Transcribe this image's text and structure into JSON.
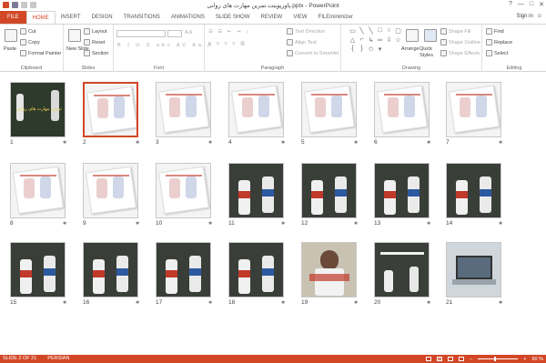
{
  "window": {
    "title": "پاورپوینت تمرین مهارت های روانی.pptx - PowerPoint",
    "controls": [
      "?",
      "—",
      "□",
      "✕"
    ]
  },
  "tabs": [
    {
      "label": "FILE"
    },
    {
      "label": "HOME"
    },
    {
      "label": "INSERT"
    },
    {
      "label": "DESIGN"
    },
    {
      "label": "TRANSITIONS"
    },
    {
      "label": "ANIMATIONS"
    },
    {
      "label": "SLIDE SHOW"
    },
    {
      "label": "REVIEW"
    },
    {
      "label": "VIEW"
    },
    {
      "label": "FILEminimizer"
    }
  ],
  "account": {
    "signin": "Sign in"
  },
  "ribbon": {
    "clipboard": {
      "label": "Clipboard",
      "paste": "Paste",
      "cut": "Cut",
      "copy": "Copy",
      "format_painter": "Format Painter"
    },
    "slides": {
      "label": "Slides",
      "new_slide": "New Slide",
      "layout": "Layout",
      "reset": "Reset",
      "section": "Section"
    },
    "font": {
      "label": "Font"
    },
    "paragraph": {
      "label": "Paragraph",
      "text_direction": "Text Direction",
      "align_text": "Align Text",
      "convert_smartart": "Convert to SmartArt"
    },
    "drawing": {
      "label": "Drawing",
      "arrange": "Arrange",
      "quick_styles": "Quick Styles",
      "shape_fill": "Shape Fill",
      "shape_outline": "Shape Outline",
      "shape_effects": "Shape Effects"
    },
    "editing": {
      "label": "Editing",
      "find": "Find",
      "replace": "Replace",
      "select": "Select"
    }
  },
  "slides": [
    {
      "number": "1",
      "title_text": "تمرین مهارت های روانی"
    },
    {
      "number": "2"
    },
    {
      "number": "3"
    },
    {
      "number": "4"
    },
    {
      "number": "5"
    },
    {
      "number": "6"
    },
    {
      "number": "7"
    },
    {
      "number": "8"
    },
    {
      "number": "9"
    },
    {
      "number": "10"
    },
    {
      "number": "11"
    },
    {
      "number": "12"
    },
    {
      "number": "13"
    },
    {
      "number": "14"
    },
    {
      "number": "15"
    },
    {
      "number": "16"
    },
    {
      "number": "17"
    },
    {
      "number": "18"
    },
    {
      "number": "19"
    },
    {
      "number": "20"
    },
    {
      "number": "21"
    }
  ],
  "selected_slide": "2",
  "status": {
    "slide_info": "SLIDE 2 OF 21",
    "language": "PERSIAN",
    "zoom": "60 %"
  },
  "colors": {
    "accent": "#d24726"
  }
}
